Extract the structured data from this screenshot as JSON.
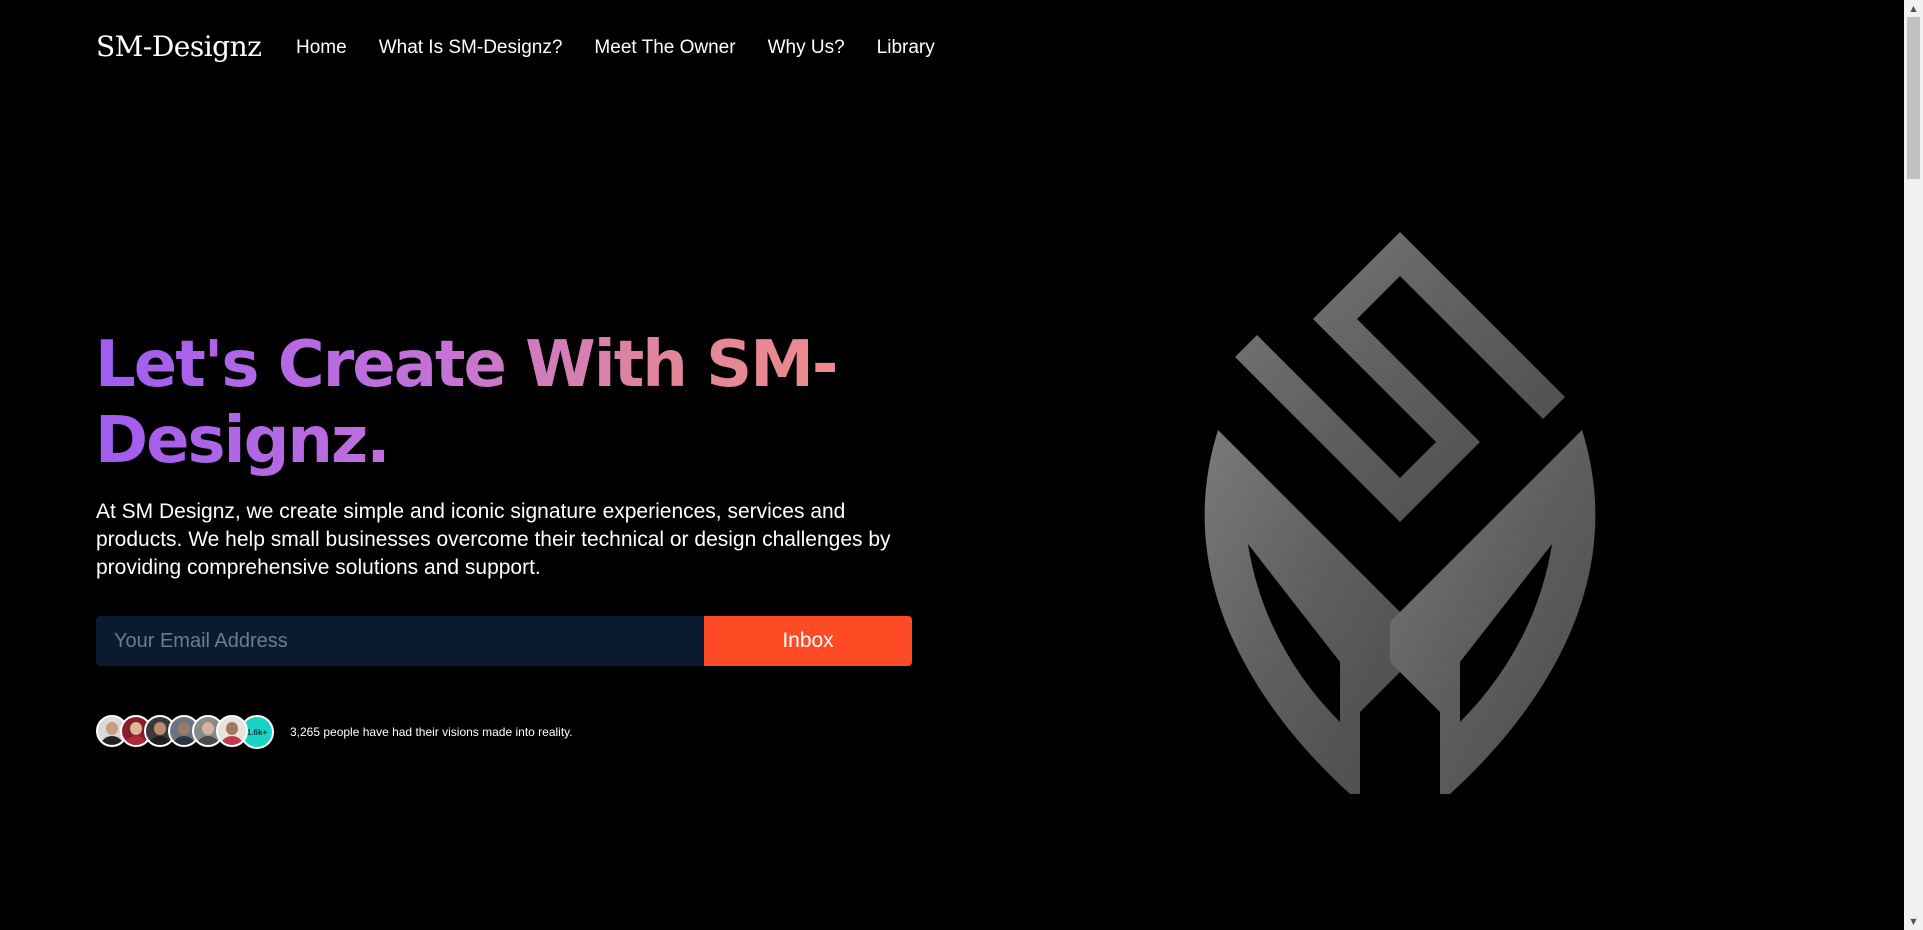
{
  "header": {
    "brand": "SM-Designz",
    "nav": [
      "Home",
      "What Is SM-Designz?",
      "Meet The Owner",
      "Why Us?",
      "Library"
    ]
  },
  "hero": {
    "title": "Let's Create With SM-Designz.",
    "description": "At SM Designz, we create simple and iconic signature experiences, services and products. We help small businesses overcome their technical or design challenges by providing comprehensive solutions and support.",
    "email_placeholder": "Your Email Address",
    "email_value": "",
    "submit_label": "Inbox",
    "avatar_count_badge": "1.6k+",
    "social_proof": "3,265 people have had their visions made into reality."
  },
  "colors": {
    "background": "#000000",
    "accent_button": "#ff4a26",
    "input_background": "#0a1a30",
    "badge": "#19d3c5",
    "gradient_start": "#a05cf0",
    "gradient_end": "#f08a8c"
  },
  "icons": [
    "sm-designz-logo-emblem",
    "scroll-up-arrow-icon",
    "scroll-down-arrow-icon"
  ]
}
